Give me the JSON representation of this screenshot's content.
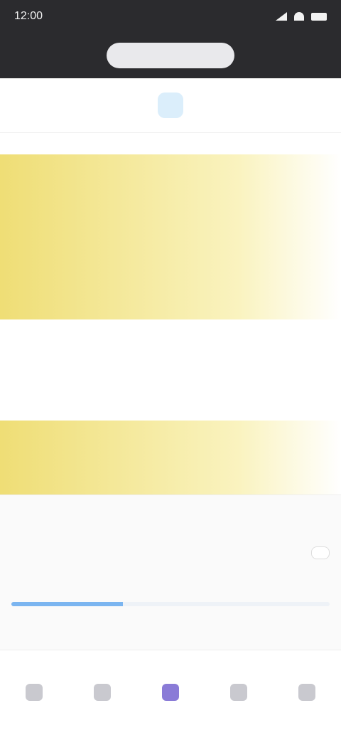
{
  "status_bar": {
    "time": "12:00",
    "battery_text": "",
    "icons": [
      "signal-icon",
      "wifi-icon",
      "battery-icon"
    ]
  },
  "header": {
    "pill_text": ""
  },
  "subnav": {
    "items": [
      {
        "label": "",
        "active": false
      },
      {
        "label": "",
        "active": true
      },
      {
        "label": "",
        "active": false
      }
    ]
  },
  "content": {
    "rows": [
      {
        "label": "",
        "value": "",
        "highlight": true
      },
      {
        "label": "",
        "value": "",
        "highlight": true
      },
      {
        "label": "",
        "value": "",
        "highlight": true
      },
      {
        "label": "",
        "value": "",
        "highlight": true
      },
      {
        "label": "",
        "value": "",
        "highlight": false
      },
      {
        "label": "",
        "value": "",
        "highlight": false
      },
      {
        "label": "",
        "value": "",
        "highlight": false
      },
      {
        "label": "",
        "value": "",
        "highlight": true
      },
      {
        "label": "",
        "value": "",
        "highlight": true
      }
    ]
  },
  "panel": {
    "row1_left": "",
    "row1_badge": "",
    "row1_right": "",
    "row2_left": "",
    "row2_right_btn": "",
    "row3_left": "",
    "row3_right": "",
    "progress_percent": 35
  },
  "bottom_nav": {
    "items": [
      {
        "label": "",
        "active": false,
        "icon": "home-icon"
      },
      {
        "label": "",
        "active": false,
        "icon": "grid-icon"
      },
      {
        "label": "",
        "active": true,
        "icon": "profile-icon"
      },
      {
        "label": "",
        "active": false,
        "icon": "chat-icon"
      },
      {
        "label": "",
        "active": false,
        "icon": "settings-icon"
      }
    ]
  },
  "colors": {
    "dark_header": "#2b2b2e",
    "highlight_yellow": "#eedc6e",
    "accent_blue": "#2b8adf",
    "accent_purple": "#8a7bd7"
  }
}
